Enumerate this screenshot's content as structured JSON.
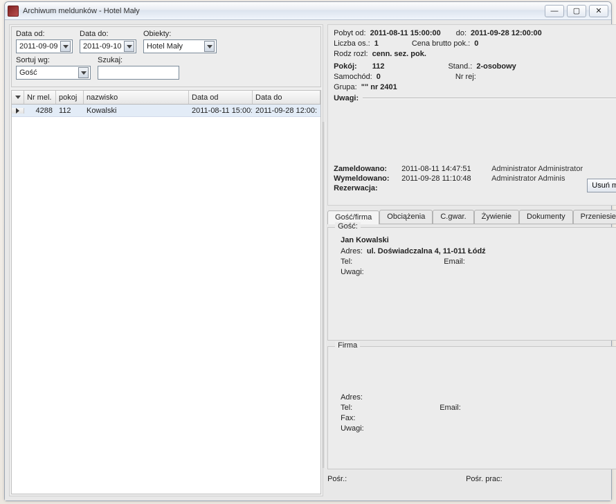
{
  "window": {
    "title": "Archiwum meldunków - Hotel Mały"
  },
  "filters": {
    "data_od_label": "Data od:",
    "data_od_value": "2011-09-09",
    "data_do_label": "Data do:",
    "data_do_value": "2011-09-10",
    "obiekty_label": "Obiekty:",
    "obiekty_value": "Hotel Mały",
    "sortuj_label": "Sortuj wg:",
    "sortuj_value": "Gość",
    "szukaj_label": "Szukaj:",
    "szukaj_value": ""
  },
  "grid": {
    "headers": {
      "nr_mel": "Nr mel.",
      "pokoj": "pokoj",
      "nazwisko": "nazwisko",
      "data_od": "Data od",
      "data_do": "Data do"
    },
    "rows": [
      {
        "nr_mel": "4288",
        "pokoj": "112",
        "nazwisko": "Kowalski",
        "data_od": "2011-08-11 15:00:",
        "data_do": "2011-09-28 12:00:"
      }
    ]
  },
  "details": {
    "pobyt_od_label": "Pobyt od:",
    "pobyt_od_value": "2011-08-11 15:00:00",
    "pobyt_do_label": "do:",
    "pobyt_do_value": "2011-09-28 12:00:00",
    "liczba_os_label": "Liczba os.:",
    "liczba_os_value": "1",
    "cena_brutto_label": "Cena brutto pok.:",
    "cena_brutto_value": "0",
    "rodz_rozl_label": "Rodz rozl:",
    "rodz_rozl_value": "cenn. sez. pok.",
    "pokoj_label": "Pokój:",
    "pokoj_value": "112",
    "stand_label": "Stand.:",
    "stand_value": "2-osobowy",
    "samochod_label": "Samochód:",
    "samochod_value": "0",
    "nrrej_label": "Nr rej:",
    "nrrej_value": "",
    "grupa_label": "Grupa:",
    "grupa_value": "\"\" nr 2401",
    "uwagi_label": "Uwagi:",
    "zameld_label": "Zameldowano:",
    "zameld_ts": "2011-08-11 14:47:51",
    "zameld_who": "Administrator Administrator",
    "wymeld_label": "Wymeldowano:",
    "wymeld_ts": "2011-09-28 11:10:48",
    "wymeld_who": "Administrator Adminis",
    "rezerw_label": "Rezerwacja:",
    "usun_label": "Usuń meldunek"
  },
  "tabs": {
    "gosc_firma": "Gość/firma",
    "obciazenia": "Obciążenia",
    "cgwar": "C.gwar.",
    "zywienie": "Żywienie",
    "dokumenty": "Dokumenty",
    "przeniesienia": "Przeniesienia"
  },
  "gosc": {
    "legend": "Gość:",
    "name": "Jan Kowalski",
    "adres_label": "Adres:",
    "adres_value": "ul. Doświadczalna 4, 11-011 Łódź",
    "tel_label": "Tel:",
    "tel_value": "",
    "email_label": "Email:",
    "email_value": "",
    "uwagi_label": "Uwagi:"
  },
  "firma": {
    "legend": "Firma",
    "adres_label": "Adres:",
    "tel_label": "Tel:",
    "email_label": "Email:",
    "fax_label": "Fax:",
    "uwagi_label": "Uwagi:"
  },
  "footer": {
    "posr_label": "Pośr.:",
    "posr_prac_label": "Pośr. prac:"
  }
}
